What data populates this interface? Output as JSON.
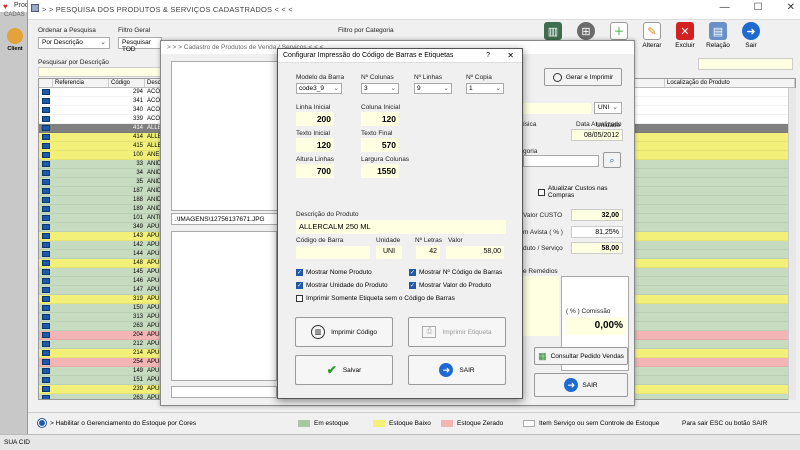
{
  "app": {
    "title": "Prod",
    "menu": "CADAS"
  },
  "main": {
    "title": "> >   PESQUISA DOS PRODUTOS & SERVIÇOS CADASTRADOS   < < <",
    "order_label": "Ordenar a Pesquisa",
    "order_value": "Por Descrição",
    "filter_label": "Filtro Geral",
    "filter_value": "Pesquisar TOD",
    "category_label": "Filtro por Categoria",
    "search_label": "Pesquisar por Descrição",
    "client_label": "Client",
    "toolbar": [
      {
        "label": "",
        "icon": "barcode-icon"
      },
      {
        "label": "",
        "icon": "calculator-icon"
      },
      {
        "label": "",
        "icon": "add-document-icon"
      },
      {
        "label": "Alterar",
        "icon": "edit-icon"
      },
      {
        "label": "Excluir",
        "icon": "delete-icon"
      },
      {
        "label": "Relação",
        "icon": "report-icon"
      },
      {
        "label": "Sair",
        "icon": "exit-icon"
      }
    ],
    "columns": [
      "Referencia",
      "Código",
      "Desc",
      "Localização do Produto"
    ],
    "rows": [
      {
        "code": "294",
        "desc": "ACOM",
        "color": "white"
      },
      {
        "code": "341",
        "desc": "ACOM",
        "color": "white"
      },
      {
        "code": "340",
        "desc": "ACOM",
        "color": "white"
      },
      {
        "code": "339",
        "desc": "ACOM",
        "color": "white"
      },
      {
        "code": "414",
        "desc": "ALLE",
        "color": "gray"
      },
      {
        "code": "414",
        "desc": "ALLE",
        "color": "yellow"
      },
      {
        "code": "415",
        "desc": "ALLE",
        "color": "yellow"
      },
      {
        "code": "100",
        "desc": "ANES",
        "color": "yellow"
      },
      {
        "code": "33",
        "desc": "ANID",
        "color": "green"
      },
      {
        "code": "34",
        "desc": "ANID",
        "color": "green"
      },
      {
        "code": "35",
        "desc": "ANID",
        "color": "green"
      },
      {
        "code": "187",
        "desc": "ANID",
        "color": "green"
      },
      {
        "code": "188",
        "desc": "ANID",
        "color": "green"
      },
      {
        "code": "189",
        "desc": "ANID",
        "color": "green"
      },
      {
        "code": "101",
        "desc": "ANTI",
        "color": "green"
      },
      {
        "code": "349",
        "desc": "APUI",
        "color": "green"
      },
      {
        "code": "143",
        "desc": "APUI",
        "color": "yellow"
      },
      {
        "code": "142",
        "desc": "APUI",
        "color": "green"
      },
      {
        "code": "144",
        "desc": "APUI",
        "color": "green"
      },
      {
        "code": "148",
        "desc": "APUI",
        "color": "yellow"
      },
      {
        "code": "145",
        "desc": "APUI",
        "color": "green"
      },
      {
        "code": "146",
        "desc": "APUI",
        "color": "green"
      },
      {
        "code": "147",
        "desc": "APUI",
        "color": "green"
      },
      {
        "code": "319",
        "desc": "APUI",
        "color": "yellow"
      },
      {
        "code": "150",
        "desc": "APUI",
        "color": "green"
      },
      {
        "code": "313",
        "desc": "APUI",
        "color": "green"
      },
      {
        "code": "263",
        "desc": "APUI",
        "color": "green"
      },
      {
        "code": "204",
        "desc": "APUI",
        "color": "red"
      },
      {
        "code": "212",
        "desc": "APUI",
        "color": "green"
      },
      {
        "code": "214",
        "desc": "APUI",
        "color": "yellow"
      },
      {
        "code": "254",
        "desc": "APUI",
        "color": "red"
      },
      {
        "code": "149",
        "desc": "APUI",
        "color": "green"
      },
      {
        "code": "151",
        "desc": "APUI",
        "color": "green"
      },
      {
        "code": "239",
        "desc": "APUI",
        "color": "yellow"
      },
      {
        "code": "263",
        "desc": "APUI",
        "color": "green"
      }
    ],
    "legend_help": "> Habilitar o Gerenciamento do Estoque por Cores",
    "legend": [
      {
        "label": "Em estoque",
        "color": "#a8c8a0"
      },
      {
        "label": "Estoque Baixo",
        "color": "#f3f07a"
      },
      {
        "label": "Estoque Zerado",
        "color": "#f2b4b4"
      },
      {
        "label": "Item Serviço ou sem Controle de Estoque",
        "color": "#ffffff"
      }
    ],
    "exit_hint": "Para sair ESC ou botão SAIR",
    "bottom_left": "SUA CID"
  },
  "mid": {
    "title": "> > >   Cadastro de Produtos de Venda / Serviços   < < <",
    "image_path": ".\\IMAGENS\\12756137671.JPG",
    "gerar_label": "Gerar e Imprimir",
    "unidade_label": "Unidade",
    "unidade_value": "UNI",
    "fisica_label": "ísica",
    "data_label": "Data Atualizado",
    "data_value": "08/05/2012",
    "categoria_label": "goria",
    "atualizar_label": "Atualizar Custos nas Compras",
    "custo_label": "Valor CUSTO",
    "custo_value": "32,00",
    "avista_label": "m Avista ( % )",
    "avista_value": "81,25%",
    "produto_label": "duto / Serviço",
    "produto_value": "58,00",
    "remedios_label": "e Remédios",
    "comissao_label": "( % ) Comissão",
    "comissao_value": "0,00%",
    "consultar_label": "Consultar Pedido Vendas",
    "sair_label": "SAIR"
  },
  "dialog": {
    "title": "Configurar Impressão do Código de Barras e Etiquetas",
    "modelo_label": "Modelo da Barra",
    "modelo_value": "code3_9",
    "ncolunas_label": "Nº Colunas",
    "ncolunas_value": "3",
    "nlinhas_label": "Nº Linhas",
    "nlinhas_value": "9",
    "ncopia_label": "Nº Copia",
    "ncopia_value": "1",
    "linha_inicial_label": "Linha Inicial",
    "linha_inicial_value": "200",
    "coluna_inicial_label": "Coluna Inicial",
    "coluna_inicial_value": "120",
    "texto_inicial_label": "Texto Inicial",
    "texto_inicial_value": "120",
    "texto_final_label": "Texto Final",
    "texto_final_value": "570",
    "altura_label": "Altura Linhas",
    "altura_value": "700",
    "largura_label": "Largura Colunas",
    "largura_value": "1550",
    "descricao_label": "Descrição do Produto",
    "descricao_value": "ALLERCALM 250 ML",
    "codbarra_label": "Código de Barra",
    "codbarra_value": "",
    "unidade_label": "Unidade",
    "unidade_value": "UNI",
    "nletras_label": "Nº Letras",
    "nletras_value": "42",
    "valor_label": "Valor",
    "valor_value": "58,00",
    "checks": [
      {
        "label": "Mostrar Nome Produto",
        "checked": true
      },
      {
        "label": "Mostrar Nº Código de Barras",
        "checked": true
      },
      {
        "label": "Mostrar Unidade do Produto",
        "checked": true
      },
      {
        "label": "Mostrar Valor do Produto",
        "checked": true
      },
      {
        "label": "Imprimir Somente Etiqueta sem o Código de Barras",
        "checked": false
      }
    ],
    "imprimir_codigo": "Imprimir Código",
    "imprimir_etiqueta": "Imprimir Etiqueta",
    "salvar": "Salvar",
    "sair": "SAIR"
  }
}
